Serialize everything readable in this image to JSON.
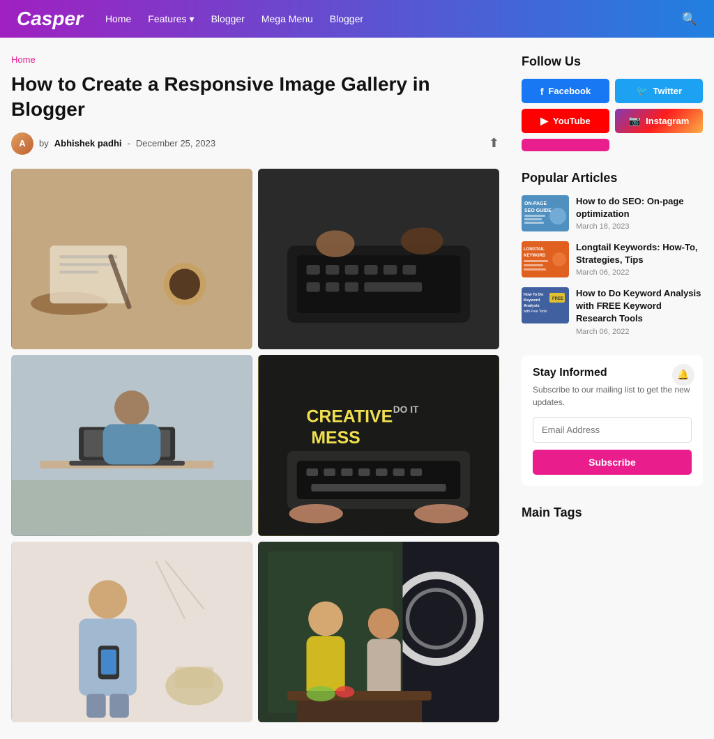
{
  "header": {
    "logo": "Casper",
    "nav": [
      {
        "label": "Home",
        "hasDropdown": false
      },
      {
        "label": "Features",
        "hasDropdown": true
      },
      {
        "label": "Blogger",
        "hasDropdown": false
      },
      {
        "label": "Mega Menu",
        "hasDropdown": false
      },
      {
        "label": "Blogger",
        "hasDropdown": false
      }
    ],
    "search_aria": "Search"
  },
  "breadcrumb": "Home",
  "article": {
    "title": "How to Create a Responsive Image Gallery in Blogger",
    "author": "Abhishek padhi",
    "date": "December 25, 2023",
    "author_initial": "A"
  },
  "sidebar": {
    "follow_us": {
      "title": "Follow Us",
      "buttons": [
        {
          "label": "Facebook",
          "icon": "f",
          "class": "btn-facebook"
        },
        {
          "label": "Twitter",
          "icon": "🐦",
          "class": "btn-twitter"
        },
        {
          "label": "YouTube",
          "icon": "▶",
          "class": "btn-youtube"
        },
        {
          "label": "Instagram",
          "icon": "📷",
          "class": "btn-instagram"
        }
      ]
    },
    "popular_articles": {
      "title": "Popular Articles",
      "items": [
        {
          "title": "How to do SEO: On-page optimization",
          "date": "March 18, 2023",
          "thumb_class": "thumb-1"
        },
        {
          "title": "Longtail Keywords: How-To, Strategies, Tips",
          "date": "March 06, 2022",
          "thumb_class": "thumb-2"
        },
        {
          "title": "How to Do Keyword Analysis with FREE Keyword Research Tools",
          "date": "March 06, 2022",
          "thumb_class": "thumb-3"
        }
      ]
    },
    "stay_informed": {
      "title": "Stay Informed",
      "description": "Subscribe to our mailing list to get the new updates.",
      "email_placeholder": "Email Address",
      "subscribe_label": "Subscribe"
    },
    "main_tags": {
      "title": "Main Tags"
    }
  },
  "gallery": [
    {
      "id": 1,
      "cls": "img-1",
      "alt": "Person writing notes with coffee"
    },
    {
      "id": 2,
      "cls": "img-2",
      "alt": "Hands on laptop keyboard"
    },
    {
      "id": 3,
      "cls": "img-3",
      "alt": "Woman working at desk"
    },
    {
      "id": 4,
      "cls": "img-4",
      "alt": "Creative mess keyboard"
    },
    {
      "id": 5,
      "cls": "img-5",
      "alt": "Woman with phone"
    },
    {
      "id": 6,
      "cls": "img-6",
      "alt": "Two women cooking"
    }
  ]
}
